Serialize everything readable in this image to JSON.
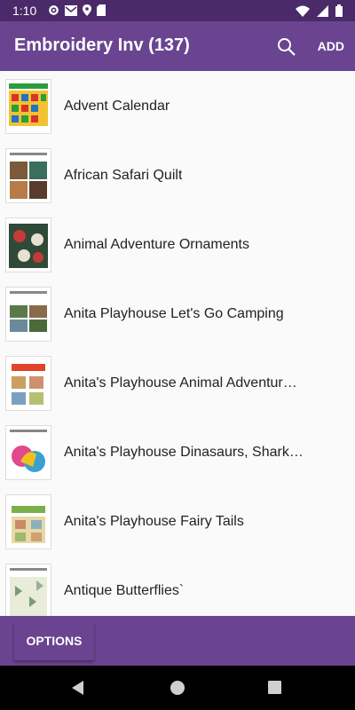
{
  "status": {
    "time": "1:10"
  },
  "app_bar": {
    "title": "Embroidery Inv (137)",
    "add_label": "ADD",
    "search_icon": "search-icon"
  },
  "items": [
    {
      "label": "Advent Calendar"
    },
    {
      "label": "African Safari Quilt"
    },
    {
      "label": "Animal Adventure Ornaments"
    },
    {
      "label": "Anita Playhouse Let's Go Camping"
    },
    {
      "label": "Anita's Playhouse Animal Adventur…"
    },
    {
      "label": "Anita's Playhouse Dinasaurs, Shark…"
    },
    {
      "label": "Anita's Playhouse Fairy Tails"
    },
    {
      "label": "Antique Butterflies`"
    }
  ],
  "bottom": {
    "options_label": "OPTIONS"
  },
  "colors": {
    "primary": "#6a4490",
    "status": "#4a2a69"
  }
}
